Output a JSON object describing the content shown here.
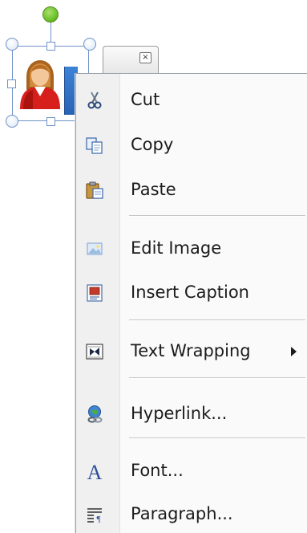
{
  "context_menu": {
    "items": [
      {
        "label": "Cut",
        "icon": "scissors-icon"
      },
      {
        "label": "Copy",
        "icon": "copy-icon"
      },
      {
        "label": "Paste",
        "icon": "paste-icon"
      },
      {
        "label": "Edit Image",
        "icon": "edit-image-icon"
      },
      {
        "label": "Insert Caption",
        "icon": "insert-caption-icon"
      },
      {
        "label": "Text Wrapping",
        "icon": "text-wrapping-icon",
        "has_submenu": true
      },
      {
        "label": "Hyperlink...",
        "icon": "hyperlink-icon"
      },
      {
        "label": "Font...",
        "icon": "font-icon"
      },
      {
        "label": "Paragraph...",
        "icon": "paragraph-icon"
      }
    ]
  },
  "mini_tab": {
    "close_glyph": "×"
  },
  "colors": {
    "selection_border": "#6f93c8",
    "rotate_handle": "#6cc22a",
    "menu_background": "#fafafa",
    "menu_gutter": "#f0f0f0",
    "menu_text": "#1b1b1b"
  }
}
